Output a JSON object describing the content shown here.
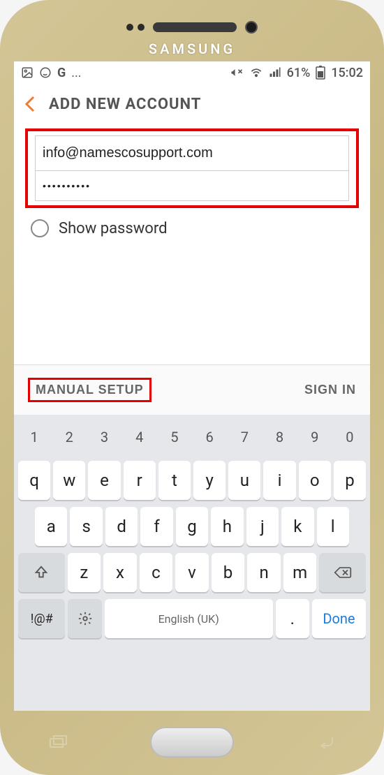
{
  "device": {
    "brand": "SAMSUNG"
  },
  "statusbar": {
    "left_ellipsis": "...",
    "battery_text": "61%",
    "time": "15:02"
  },
  "header": {
    "title": "ADD NEW ACCOUNT"
  },
  "form": {
    "email": "info@namescosupport.com",
    "password_mask": "••••••••••",
    "show_password_label": "Show password"
  },
  "actions": {
    "manual": "MANUAL SETUP",
    "signin": "SIGN IN"
  },
  "keyboard": {
    "numbers": [
      "1",
      "2",
      "3",
      "4",
      "5",
      "6",
      "7",
      "8",
      "9",
      "0"
    ],
    "row1": [
      "q",
      "w",
      "e",
      "r",
      "t",
      "y",
      "u",
      "i",
      "o",
      "p"
    ],
    "row2": [
      "a",
      "s",
      "d",
      "f",
      "g",
      "h",
      "j",
      "k",
      "l"
    ],
    "row3": [
      "z",
      "x",
      "c",
      "v",
      "b",
      "n",
      "m"
    ],
    "sym": "!@#",
    "space_label": "English (UK)",
    "period": ".",
    "done": "Done"
  }
}
